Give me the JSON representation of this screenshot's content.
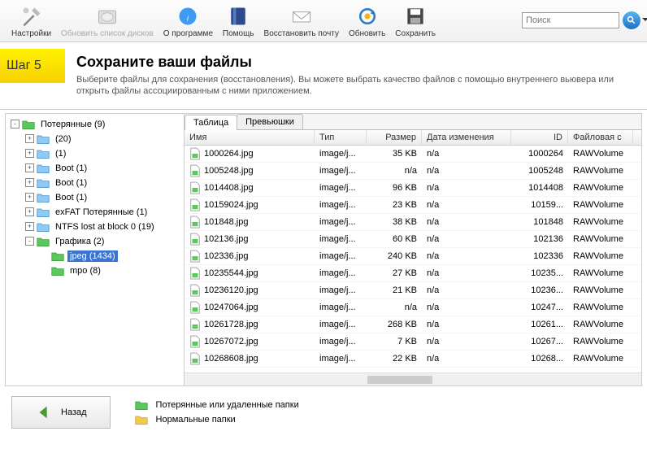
{
  "toolbar": {
    "settings": "Настройки",
    "refresh_disks": "Обновить список дисков",
    "about": "О программе",
    "help": "Помощь",
    "restore_mail": "Восстановить почту",
    "refresh": "Обновить",
    "save": "Сохранить"
  },
  "search": {
    "placeholder": "Поиск"
  },
  "step": {
    "label": "Шаг 5",
    "title": "Сохраните ваши файлы",
    "desc": "Выберите файлы для сохранения (восстановления). Вы можете выбрать качество файлов с помощью внутреннего вьювера или открыть файлы ассоциированным с ними приложением."
  },
  "tree": [
    {
      "depth": 0,
      "exp": "-",
      "kind": "lost",
      "label": "Потерянные (9)"
    },
    {
      "depth": 1,
      "exp": "+",
      "kind": "blue",
      "label": "(20)"
    },
    {
      "depth": 1,
      "exp": "+",
      "kind": "blue",
      "label": "(1)"
    },
    {
      "depth": 1,
      "exp": "+",
      "kind": "blue",
      "label": "Boot (1)"
    },
    {
      "depth": 1,
      "exp": "+",
      "kind": "blue",
      "label": "Boot (1)"
    },
    {
      "depth": 1,
      "exp": "+",
      "kind": "blue",
      "label": "Boot (1)"
    },
    {
      "depth": 1,
      "exp": "+",
      "kind": "blue",
      "label": "exFAT Потерянные (1)"
    },
    {
      "depth": 1,
      "exp": "+",
      "kind": "blue",
      "label": "NTFS lost at block 0 (19)"
    },
    {
      "depth": 1,
      "exp": "-",
      "kind": "green",
      "label": "Графика (2)"
    },
    {
      "depth": 2,
      "exp": "",
      "kind": "green",
      "label": "jpeg (1434)",
      "selected": true
    },
    {
      "depth": 2,
      "exp": "",
      "kind": "green",
      "label": "mpo (8)"
    }
  ],
  "tabs": {
    "table": "Таблица",
    "thumbs": "Превьюшки"
  },
  "columns": {
    "name": "Имя",
    "type": "Тип",
    "size": "Размер",
    "date": "Дата изменения",
    "id": "ID",
    "fs": "Файловая с"
  },
  "files": [
    {
      "name": "1000264.jpg",
      "type": "image/j...",
      "size": "35 KB",
      "date": "n/a",
      "id": "1000264",
      "fs": "RAWVolume"
    },
    {
      "name": "1005248.jpg",
      "type": "image/j...",
      "size": "n/a",
      "date": "n/a",
      "id": "1005248",
      "fs": "RAWVolume"
    },
    {
      "name": "1014408.jpg",
      "type": "image/j...",
      "size": "96 KB",
      "date": "n/a",
      "id": "1014408",
      "fs": "RAWVolume"
    },
    {
      "name": "10159024.jpg",
      "type": "image/j...",
      "size": "23 KB",
      "date": "n/a",
      "id": "10159...",
      "fs": "RAWVolume"
    },
    {
      "name": "101848.jpg",
      "type": "image/j...",
      "size": "38 KB",
      "date": "n/a",
      "id": "101848",
      "fs": "RAWVolume"
    },
    {
      "name": "102136.jpg",
      "type": "image/j...",
      "size": "60 KB",
      "date": "n/a",
      "id": "102136",
      "fs": "RAWVolume"
    },
    {
      "name": "102336.jpg",
      "type": "image/j...",
      "size": "240 KB",
      "date": "n/a",
      "id": "102336",
      "fs": "RAWVolume"
    },
    {
      "name": "10235544.jpg",
      "type": "image/j...",
      "size": "27 KB",
      "date": "n/a",
      "id": "10235...",
      "fs": "RAWVolume"
    },
    {
      "name": "10236120.jpg",
      "type": "image/j...",
      "size": "21 KB",
      "date": "n/a",
      "id": "10236...",
      "fs": "RAWVolume"
    },
    {
      "name": "10247064.jpg",
      "type": "image/j...",
      "size": "n/a",
      "date": "n/a",
      "id": "10247...",
      "fs": "RAWVolume"
    },
    {
      "name": "10261728.jpg",
      "type": "image/j...",
      "size": "268 KB",
      "date": "n/a",
      "id": "10261...",
      "fs": "RAWVolume"
    },
    {
      "name": "10267072.jpg",
      "type": "image/j...",
      "size": "7 KB",
      "date": "n/a",
      "id": "10267...",
      "fs": "RAWVolume"
    },
    {
      "name": "10268608.jpg",
      "type": "image/j...",
      "size": "22 KB",
      "date": "n/a",
      "id": "10268...",
      "fs": "RAWVolume"
    }
  ],
  "footer": {
    "back": "Назад",
    "legend_lost": "Потерянные или удаленные папки",
    "legend_normal": "Нормальные папки"
  }
}
